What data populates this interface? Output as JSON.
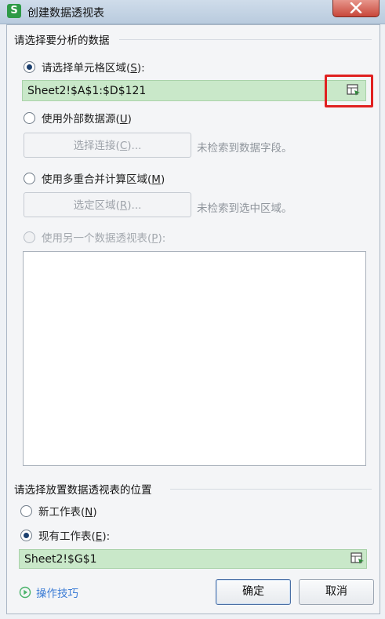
{
  "window": {
    "app_icon_letter": "S",
    "title": "创建数据透视表"
  },
  "source_section": {
    "heading": "请选择要分析的数据",
    "option_range": {
      "label_pre": "请选择单元格区域(",
      "key": "S",
      "label_post": "):",
      "checked": true
    },
    "range_value": "Sheet2!$A$1:$D$121",
    "option_external": {
      "label_pre": "使用外部数据源(",
      "key": "U",
      "label_post": ")"
    },
    "select_connection": {
      "label_pre": "选择连接(",
      "key": "C",
      "label_post": ")..."
    },
    "external_hint": "未检索到数据字段。",
    "option_multi": {
      "label_pre": "使用多重合并计算区域(",
      "key": "M",
      "label_post": ")"
    },
    "select_region": {
      "label_pre": "选定区域(",
      "key": "R",
      "label_post": ")..."
    },
    "multi_hint": "未检索到选中区域。",
    "option_other": {
      "label_pre": "使用另一个数据透视表(",
      "key": "P",
      "label_post": "):"
    }
  },
  "placement_section": {
    "heading": "请选择放置数据透视表的位置",
    "option_new": {
      "label_pre": "新工作表(",
      "key": "N",
      "label_post": ")"
    },
    "option_existing": {
      "label_pre": "现有工作表(",
      "key": "E",
      "label_post": "):",
      "checked": true
    },
    "location_value": "Sheet2!$G$1"
  },
  "footer": {
    "tips_label": "操作技巧",
    "ok_label": "确定",
    "cancel_label": "取消"
  },
  "colors": {
    "range_fill": "#c9e8c9",
    "highlight": "#e02020",
    "app_icon": "#2e9a47",
    "tips": "#3a7bd5"
  },
  "icons": [
    "app-logo-icon",
    "close-icon",
    "range-picker-icon",
    "tips-icon"
  ]
}
